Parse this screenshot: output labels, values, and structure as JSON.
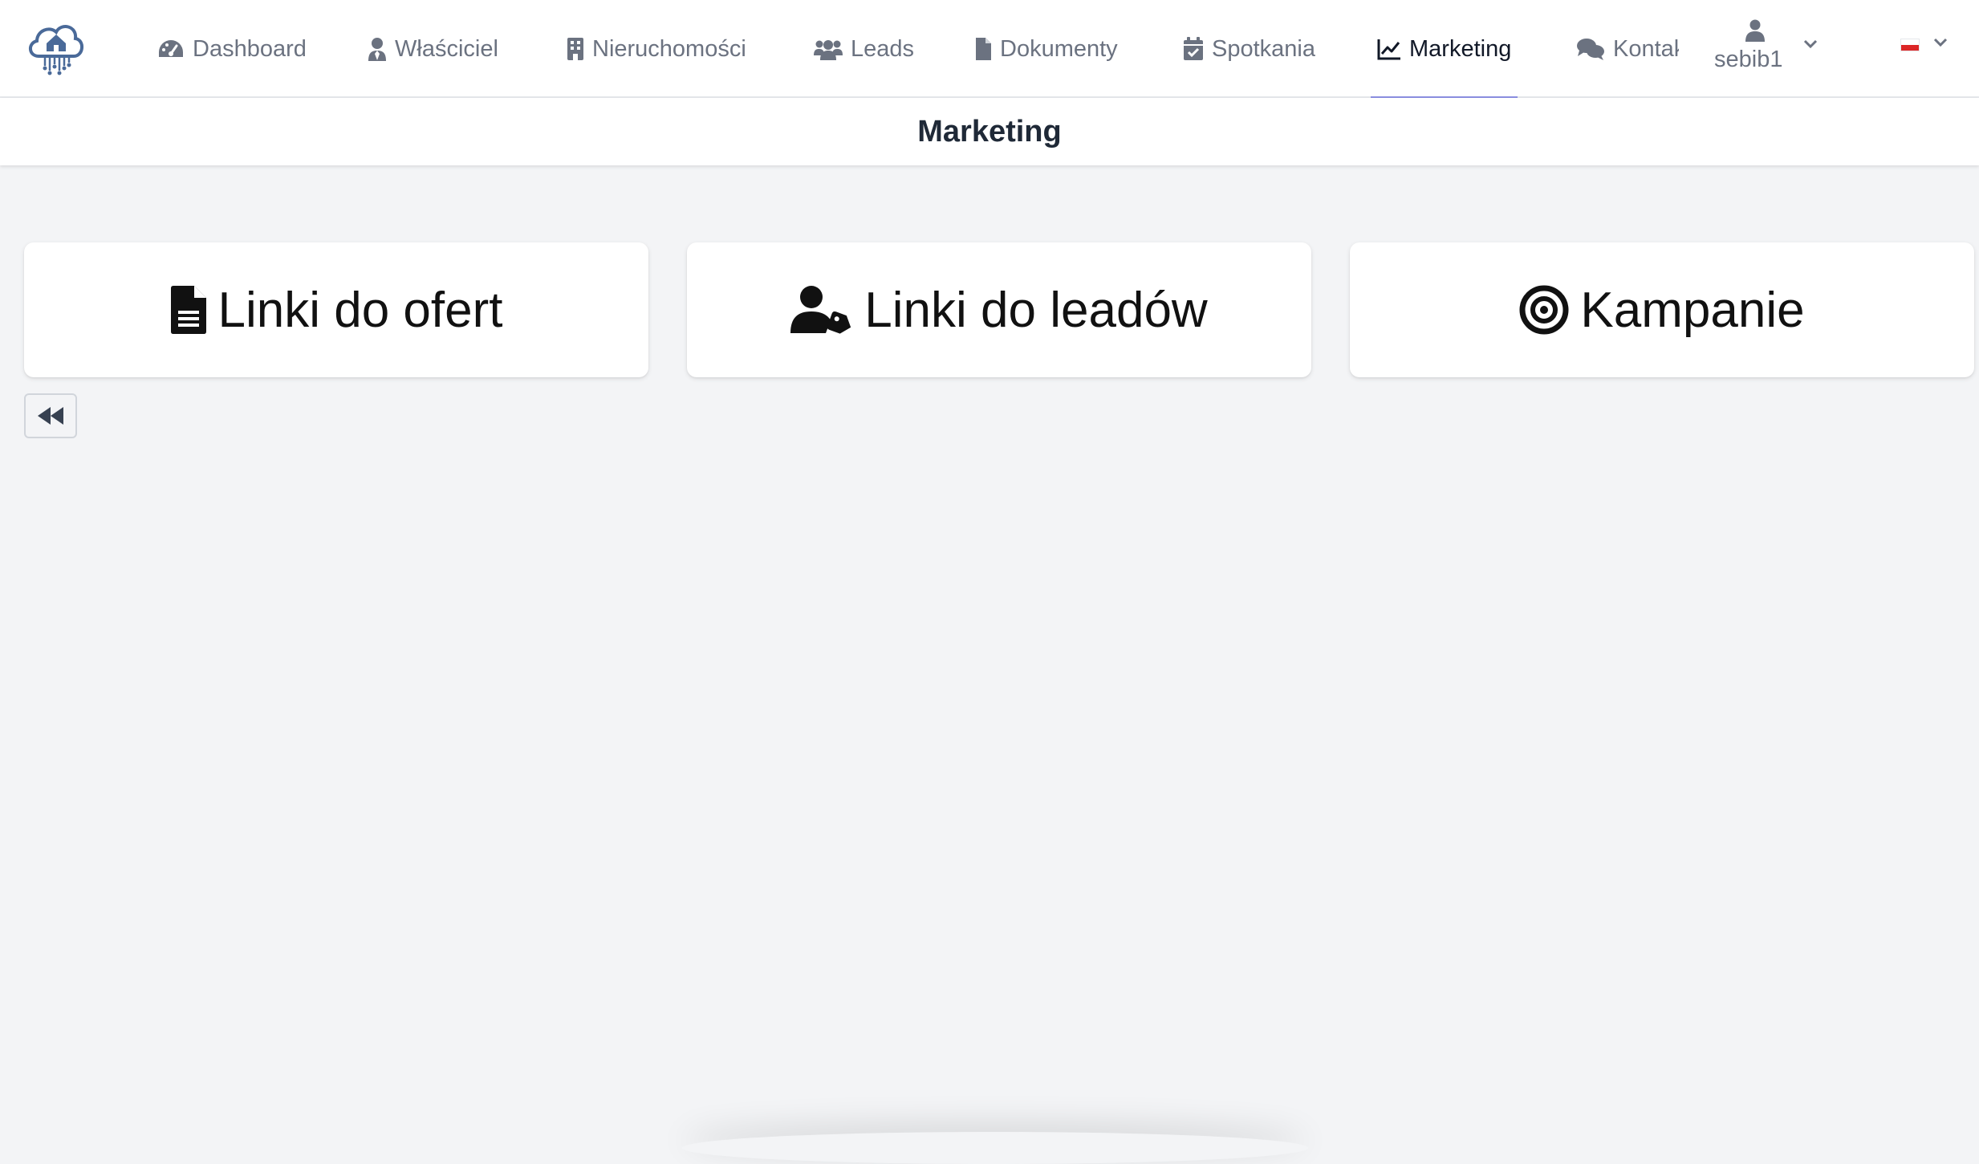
{
  "nav": {
    "logo_icon": "cloud-house-logo",
    "items": [
      {
        "label": "Dashboard",
        "icon": "gauge-icon"
      },
      {
        "label": "Właściciel",
        "icon": "user-tie-icon"
      },
      {
        "label": "Nieruchomości",
        "icon": "building-icon"
      },
      {
        "label": "Leads",
        "icon": "users-icon"
      },
      {
        "label": "Dokumenty",
        "icon": "file-icon"
      },
      {
        "label": "Spotkania",
        "icon": "calendar-check-icon"
      },
      {
        "label": "Marketing",
        "icon": "chart-line-icon",
        "active": true
      },
      {
        "label": "Kontakt",
        "icon": "comments-icon"
      }
    ],
    "user": {
      "name": "sebib1",
      "icon": "user-icon"
    },
    "language": {
      "flag": "pl-flag",
      "icon": "chevron-down-icon"
    }
  },
  "page": {
    "title": "Marketing"
  },
  "cards": [
    {
      "label": "Linki do ofert",
      "icon": "file-lines-icon"
    },
    {
      "label": "Linki do leadów",
      "icon": "user-tag-icon"
    },
    {
      "label": "Kampanie",
      "icon": "bullseye-icon"
    }
  ],
  "back_button": {
    "icon": "backward-icon"
  },
  "colors": {
    "nav_text": "#6b7280",
    "nav_active_text": "#111827",
    "active_underline": "#8b8fe0",
    "logo": "#4a6a99",
    "background": "#f3f4f6"
  }
}
